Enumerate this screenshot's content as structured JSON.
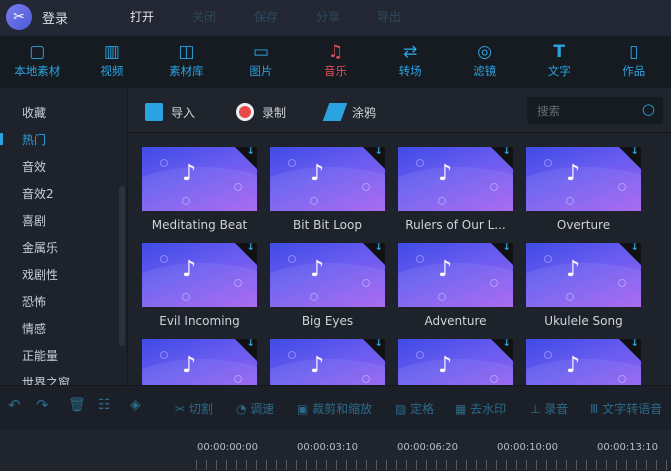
{
  "topbar": {
    "login": "登录",
    "menu": [
      {
        "label": "打开",
        "enabled": true
      },
      {
        "label": "关闭",
        "enabled": false
      },
      {
        "label": "保存",
        "enabled": false
      },
      {
        "label": "分享",
        "enabled": false
      },
      {
        "label": "导出",
        "enabled": false
      }
    ]
  },
  "nav": [
    {
      "label": "本地素材",
      "icon": "box-icon"
    },
    {
      "label": "视频",
      "icon": "film-icon"
    },
    {
      "label": "素材库",
      "icon": "library-icon"
    },
    {
      "label": "图片",
      "icon": "image-icon"
    },
    {
      "label": "音乐",
      "icon": "music-icon",
      "active": true
    },
    {
      "label": "转场",
      "icon": "transition-icon"
    },
    {
      "label": "滤镜",
      "icon": "filter-icon"
    },
    {
      "label": "文字",
      "icon": "text-icon"
    },
    {
      "label": "作品",
      "icon": "folder-icon"
    }
  ],
  "sidebar": [
    "收藏",
    "热门",
    "音效",
    "音效2",
    "喜剧",
    "金属乐",
    "戏剧性",
    "恐怖",
    "情感",
    "正能量",
    "世界之窗"
  ],
  "sidebar_active": "热门",
  "toolbar": {
    "import": "导入",
    "record": "录制",
    "doodle": "涂鸦",
    "search_placeholder": "搜索"
  },
  "tracks": [
    "Meditating Beat",
    "Bit Bit Loop",
    "Rulers of Our L...",
    "Overture",
    "Evil Incoming",
    "Big Eyes",
    "Adventure",
    "Ukulele Song",
    "",
    "",
    "",
    ""
  ],
  "edit_tools": [
    "切割",
    "调速",
    "裁剪和缩放",
    "定格",
    "去水印",
    "录音",
    "文字转语音"
  ],
  "timecodes": [
    "00:00:00:00",
    "00:00:03:10",
    "00:00:06:20",
    "00:00:10:00",
    "00:00:13:10"
  ],
  "colors": {
    "accent": "#2aa3e0",
    "active_nav": "#e8505b"
  }
}
